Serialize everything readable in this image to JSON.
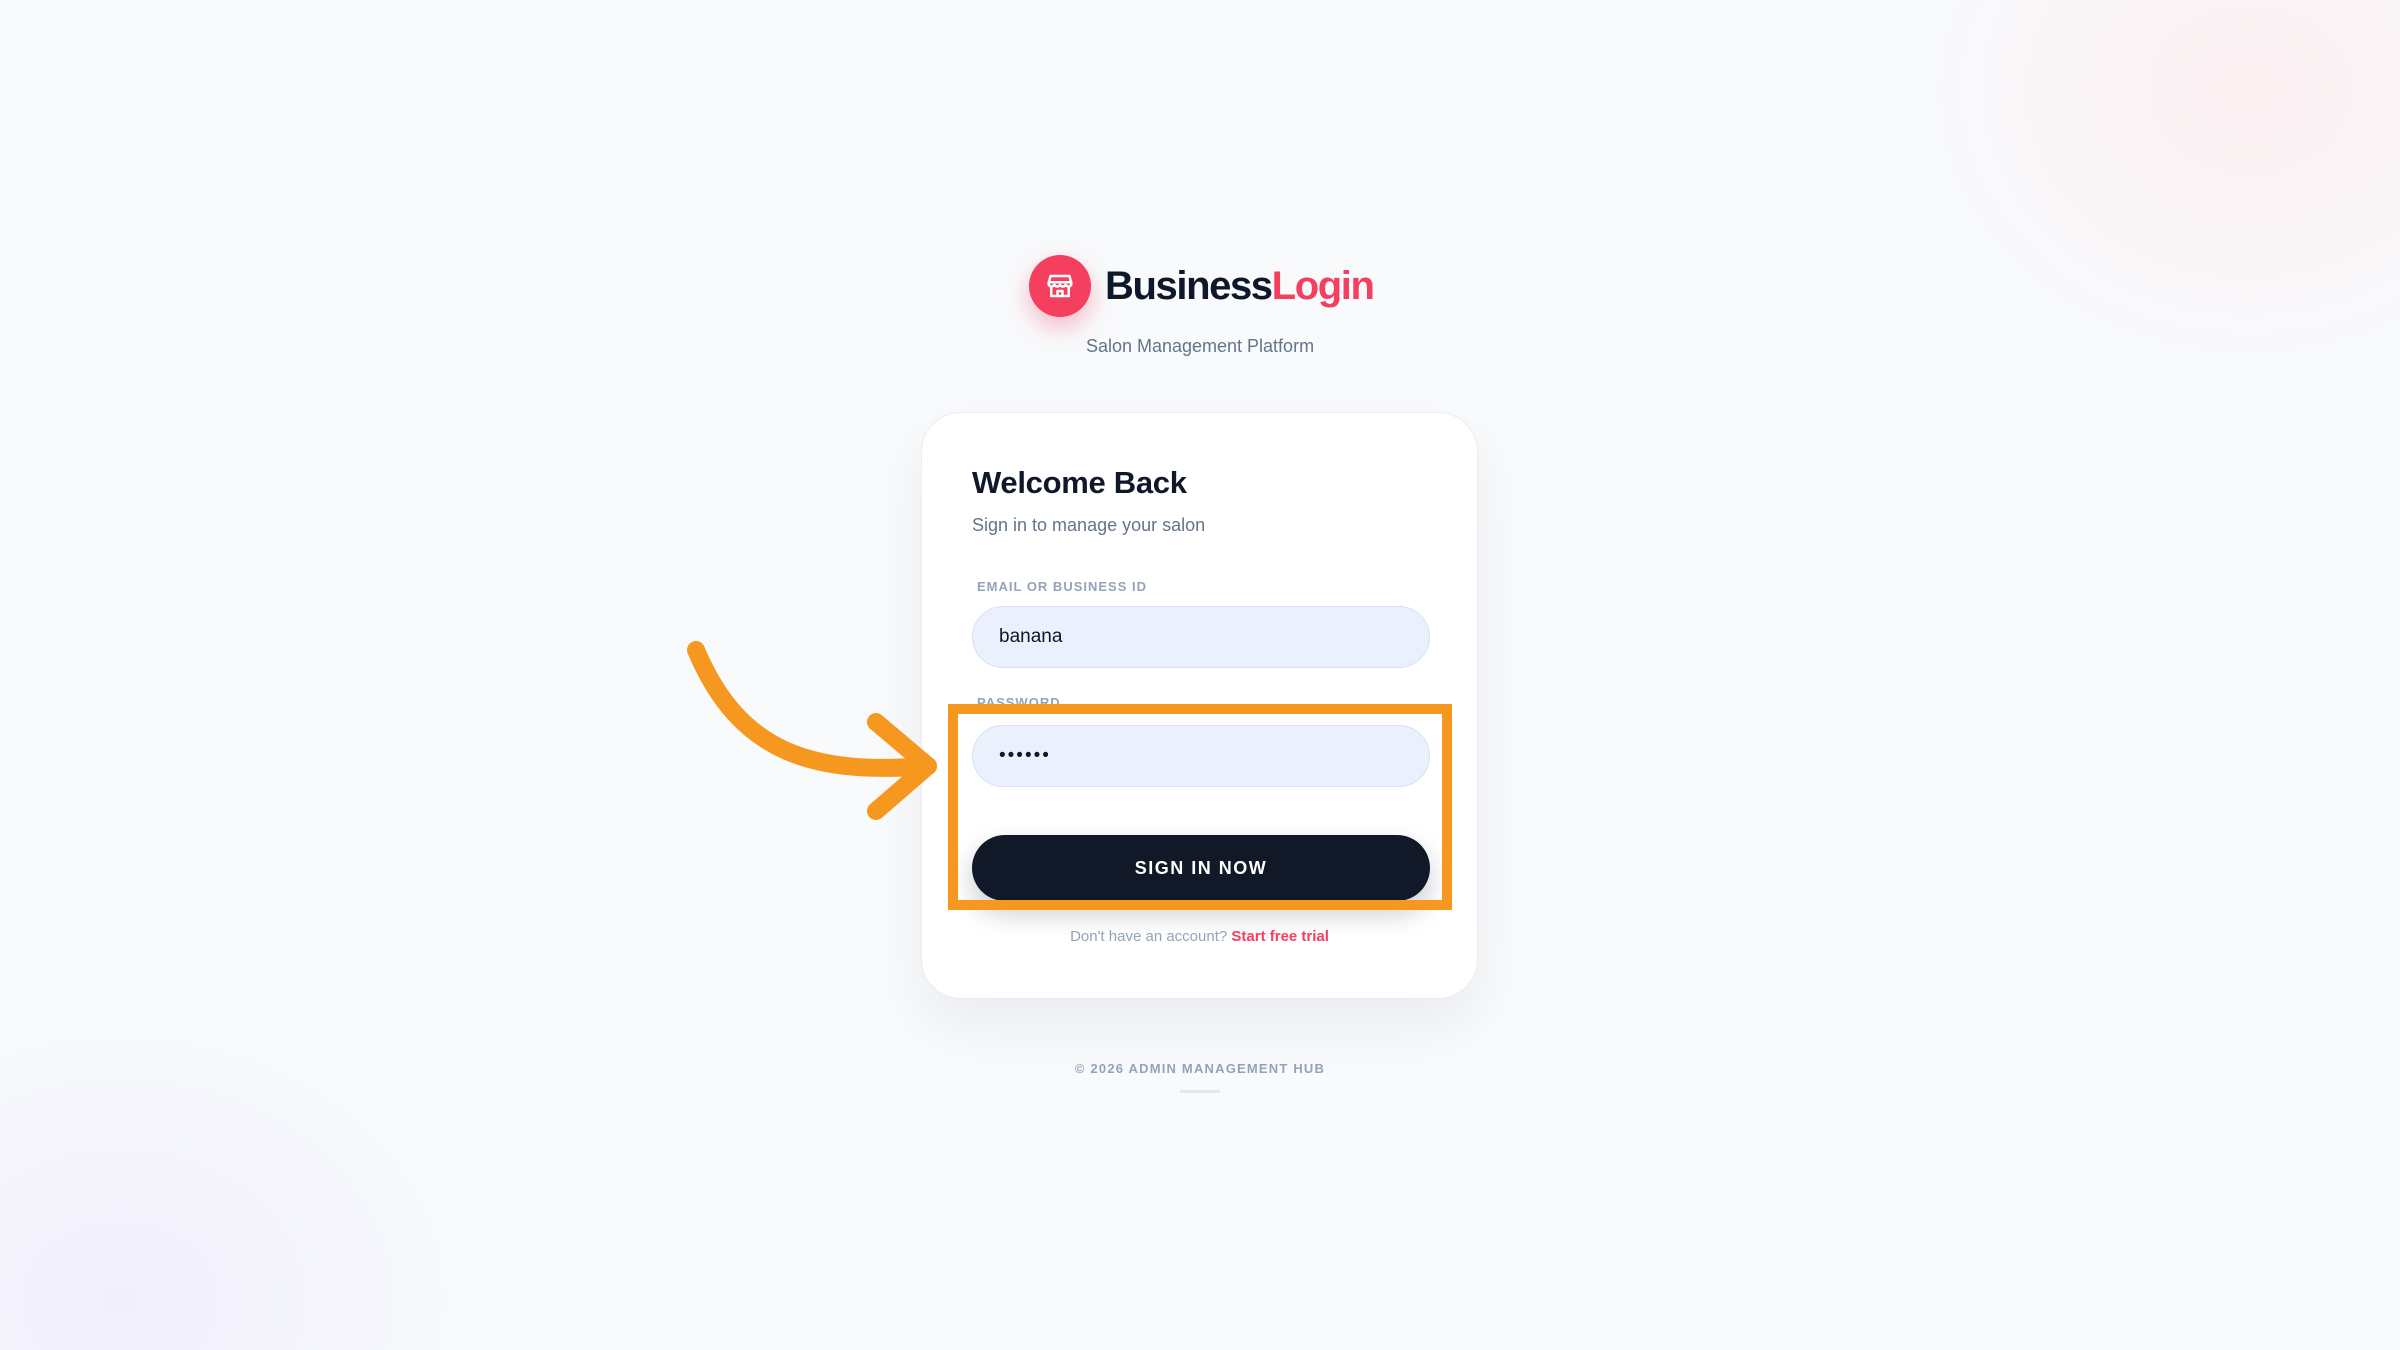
{
  "brand": {
    "name_primary": "Business",
    "name_accent": "Login",
    "tagline": "Salon Management Platform",
    "logo_icon": "storefront-icon"
  },
  "card": {
    "title": "Welcome Back",
    "subtitle": "Sign in to manage your salon",
    "email": {
      "label": "EMAIL OR BUSINESS ID",
      "value": "banana"
    },
    "password": {
      "label": "PASSWORD",
      "value": "••••••"
    },
    "submit_label": "SIGN IN NOW",
    "signup_prompt": "Don't have an account?",
    "signup_link": "Start free trial"
  },
  "footer": {
    "copyright": "© 2026 ADMIN MANAGEMENT HUB"
  },
  "colors": {
    "accent": "#f43f5e",
    "dark": "#111827",
    "annotation": "#f6981f",
    "input_bg": "#eaf0fc",
    "page_bg": "#f8fafc"
  },
  "annotation": {
    "type": "highlight-with-arrow",
    "target": "password field and sign in button"
  }
}
